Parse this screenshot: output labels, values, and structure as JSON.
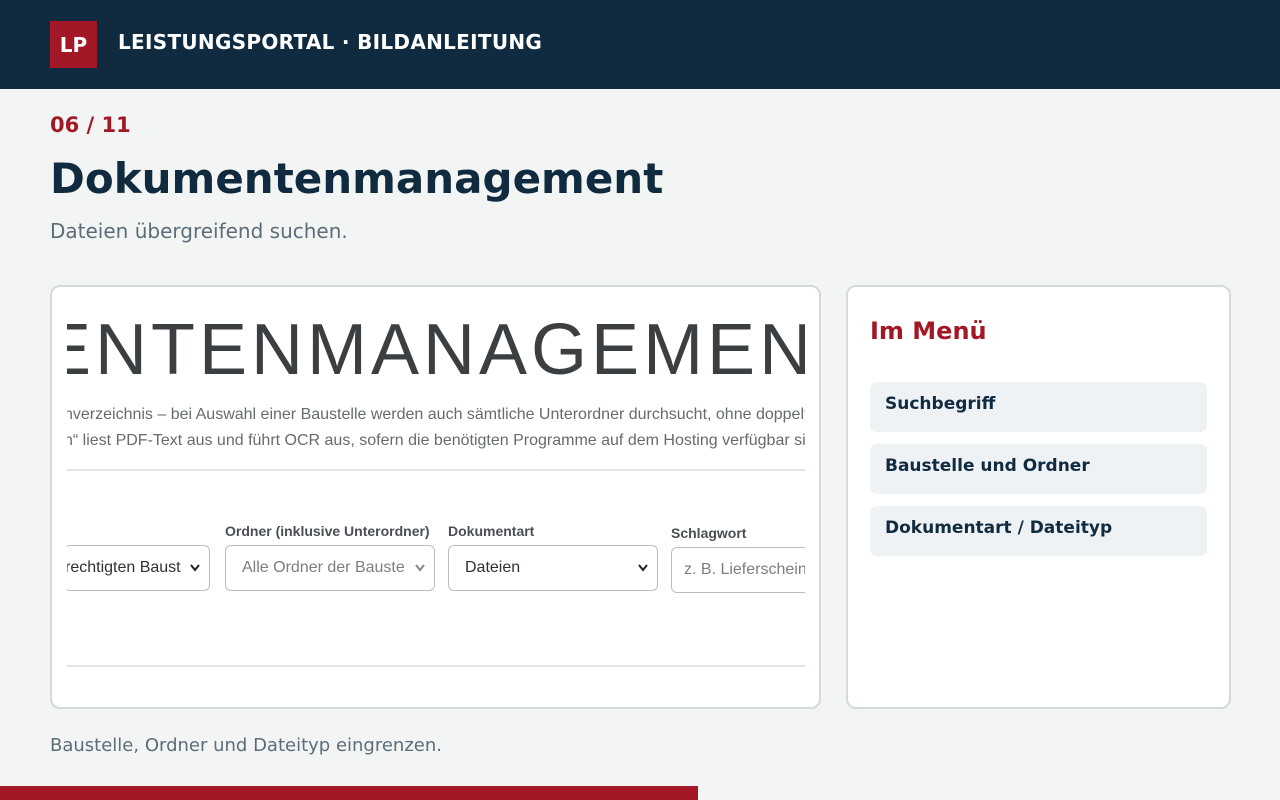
{
  "header": {
    "logo_text": "LP",
    "title": "LEISTUNGSPORTAL · BILDANLEITUNG"
  },
  "step": {
    "label": "06 / 11",
    "current": 6,
    "total": 11
  },
  "page": {
    "title": "Dokumentenmanagement",
    "subtitle": "Dateien übergreifend suchen.",
    "caption": "Baustelle, Ordner und Dateityp eingrenzen."
  },
  "screenshot": {
    "heading": "ENTENMANAGEMEN",
    "description_line1": "nverzeichnis – bei Auswahl einer Baustelle werden auch sämtliche Unterordner durchsucht, ohne doppelt",
    "description_line2": "n“ liest PDF-Text aus und führt OCR aus, sofern die benötigten Programme auf dem Hosting verfügbar sir",
    "fields": [
      {
        "label": "",
        "value": "rechtigten Baust",
        "kind": "select"
      },
      {
        "label": "Ordner (inklusive Unterordner)",
        "value": "Alle Ordner der Bauste",
        "kind": "select"
      },
      {
        "label": "Dokumentart",
        "value": "Dateien",
        "kind": "select"
      },
      {
        "label": "Schlagwort",
        "placeholder": "z. B. Lieferschein",
        "kind": "input"
      }
    ]
  },
  "menu": {
    "title": "Im Menü",
    "items": [
      {
        "label": "Suchbegriff"
      },
      {
        "label": "Baustelle und Ordner"
      },
      {
        "label": "Dokumentart / Dateityp"
      }
    ]
  },
  "colors": {
    "brand": "#a31826",
    "navy": "#102b3f",
    "muted_text": "#5c6d7a"
  },
  "progress": {
    "fraction": 0.545
  }
}
